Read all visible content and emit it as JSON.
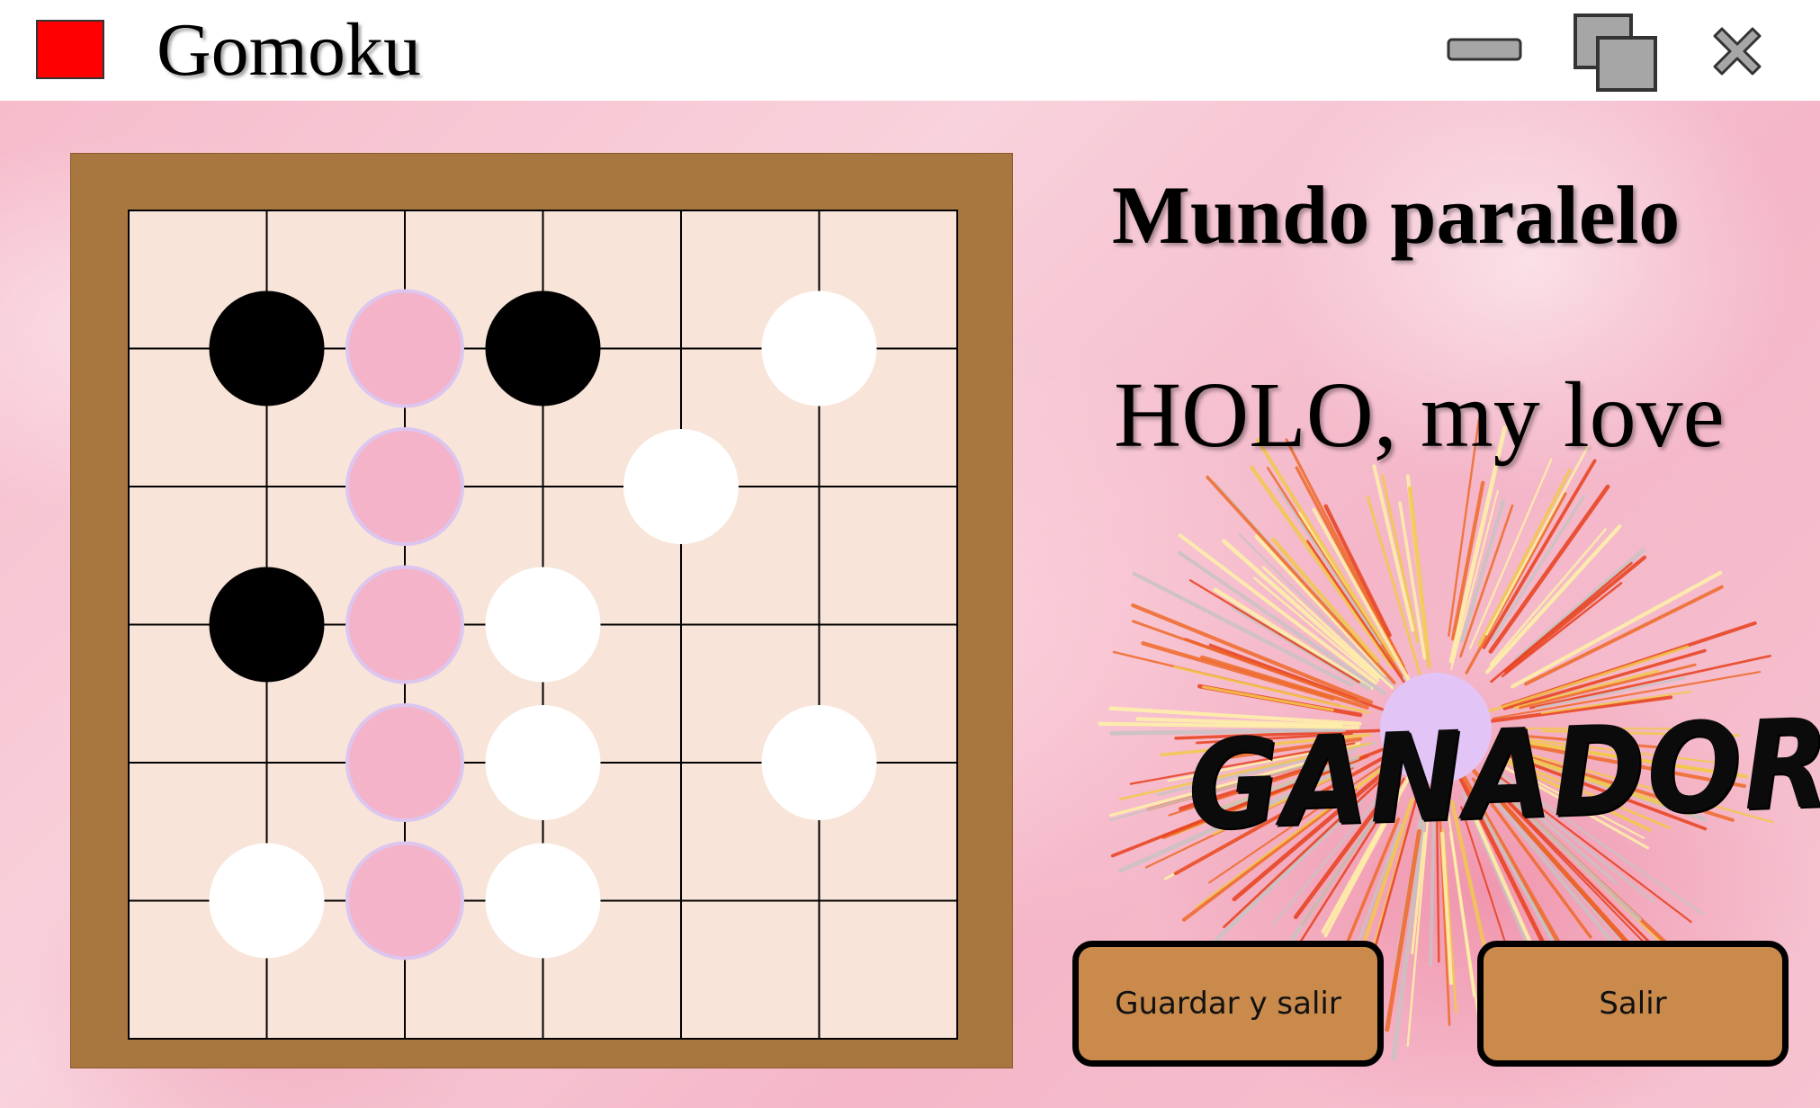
{
  "window": {
    "title": "Gomoku",
    "app_icon": "red-square-icon",
    "controls": [
      "minimize-icon",
      "maximize-icon",
      "close-icon"
    ],
    "app_icon_color": "#ff0000"
  },
  "board": {
    "size": 6,
    "frame_color": "#a8773f",
    "surface_color": "#f8e4d8",
    "highlight_color": "#f4b3c8",
    "highlight_ring_color": "#dcc6f0",
    "stones": [
      {
        "col": 1,
        "row": 1,
        "color": "black"
      },
      {
        "col": 2,
        "row": 1,
        "color": "pink"
      },
      {
        "col": 3,
        "row": 1,
        "color": "black"
      },
      {
        "col": 5,
        "row": 1,
        "color": "white"
      },
      {
        "col": 2,
        "row": 2,
        "color": "pink"
      },
      {
        "col": 4,
        "row": 2,
        "color": "white"
      },
      {
        "col": 1,
        "row": 3,
        "color": "black"
      },
      {
        "col": 2,
        "row": 3,
        "color": "pink"
      },
      {
        "col": 3,
        "row": 3,
        "color": "white"
      },
      {
        "col": 2,
        "row": 4,
        "color": "pink"
      },
      {
        "col": 3,
        "row": 4,
        "color": "white"
      },
      {
        "col": 5,
        "row": 4,
        "color": "white"
      },
      {
        "col": 1,
        "row": 5,
        "color": "white"
      },
      {
        "col": 2,
        "row": 5,
        "color": "pink"
      },
      {
        "col": 3,
        "row": 5,
        "color": "white"
      }
    ]
  },
  "panel": {
    "level_name": "Mundo paralelo",
    "player_name": "HOLO, my love",
    "winner_label": "GANADOR",
    "winner_stone_color": "#e2c4f6",
    "firework_icon": "firework-icon"
  },
  "buttons": {
    "save_exit": "Guardar y salir",
    "exit": "Salir",
    "color": "#c98a4b"
  }
}
